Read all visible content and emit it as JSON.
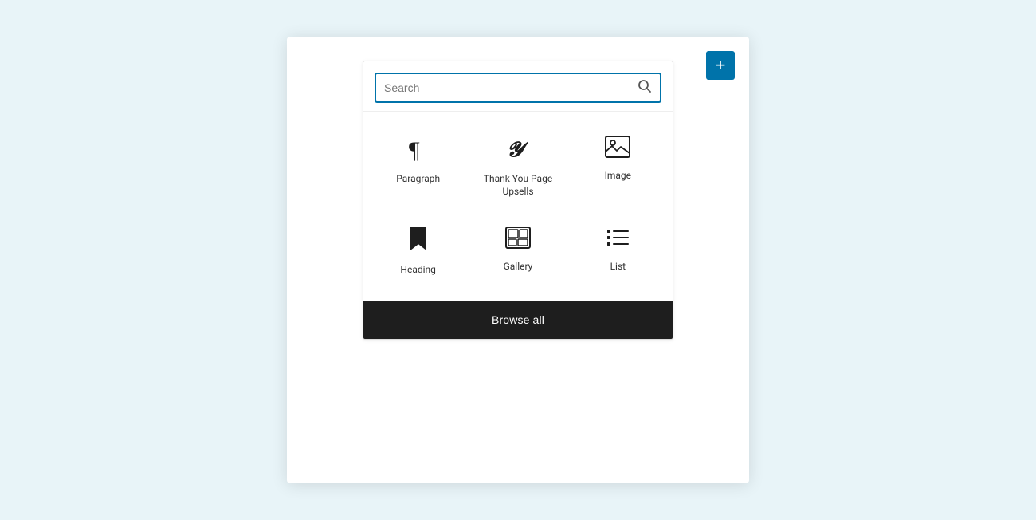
{
  "page": {
    "background": "#e8f4f8",
    "add_button_label": "+",
    "add_button_color": "#0073aa"
  },
  "search": {
    "placeholder": "Search",
    "icon": "🔍"
  },
  "blocks": [
    {
      "id": "paragraph",
      "label": "Paragraph",
      "icon_type": "paragraph"
    },
    {
      "id": "thank-you-page-upsells",
      "label": "Thank You Page Upsells",
      "icon_type": "yoast"
    },
    {
      "id": "image",
      "label": "Image",
      "icon_type": "image"
    },
    {
      "id": "heading",
      "label": "Heading",
      "icon_type": "heading"
    },
    {
      "id": "gallery",
      "label": "Gallery",
      "icon_type": "gallery"
    },
    {
      "id": "list",
      "label": "List",
      "icon_type": "list"
    }
  ],
  "browse_all_label": "Browse all"
}
